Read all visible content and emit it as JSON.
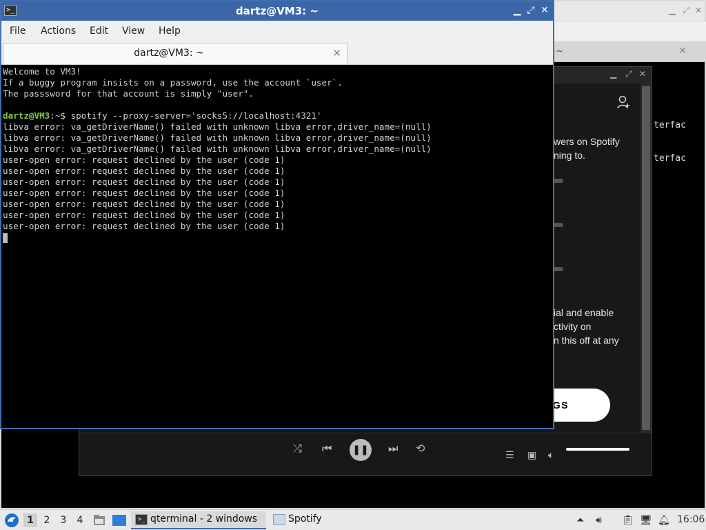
{
  "back_window": {
    "tab_label": "~",
    "text_lines": [
      "terfac",
      "terfac"
    ]
  },
  "spotify": {
    "text": {
      "l1": "wers on Spotify",
      "l2": "ning to.",
      "l3": "ial and enable",
      "l4": "ctivity on",
      "l5": "n this off at any"
    },
    "settings_button": "NGS",
    "volume_fraction": 1.0
  },
  "terminal": {
    "window_title": "dartz@VM3: ~",
    "menu": [
      "File",
      "Actions",
      "Edit",
      "View",
      "Help"
    ],
    "tab_label": "dartz@VM3: ~",
    "lines": [
      "Welcome to VM3!",
      "If a buggy program insists on a password, use the account `user`.",
      "The passsword for that account is simply \"user\".",
      "",
      "libva error: va_getDriverName() failed with unknown libva error,driver_name=(null)",
      "libva error: va_getDriverName() failed with unknown libva error,driver_name=(null)",
      "libva error: va_getDriverName() failed with unknown libva error,driver_name=(null)",
      "user-open error: request declined by the user (code 1)",
      "user-open error: request declined by the user (code 1)",
      "user-open error: request declined by the user (code 1)",
      "user-open error: request declined by the user (code 1)",
      "user-open error: request declined by the user (code 1)",
      "user-open error: request declined by the user (code 1)",
      "user-open error: request declined by the user (code 1)"
    ],
    "prompt": "dartz@VM3",
    "prompt_suffix": ":~$ ",
    "command": "spotify --proxy-server='socks5://localhost:4321'"
  },
  "taskbar": {
    "desktops": [
      "1",
      "2",
      "3",
      "4"
    ],
    "active_desktop": "1",
    "tasks": [
      {
        "label": "qterminal - 2 windows",
        "icon": "terminal-icon"
      },
      {
        "label": "Spotify",
        "icon": "window-icon"
      }
    ],
    "clock": "16:06"
  }
}
